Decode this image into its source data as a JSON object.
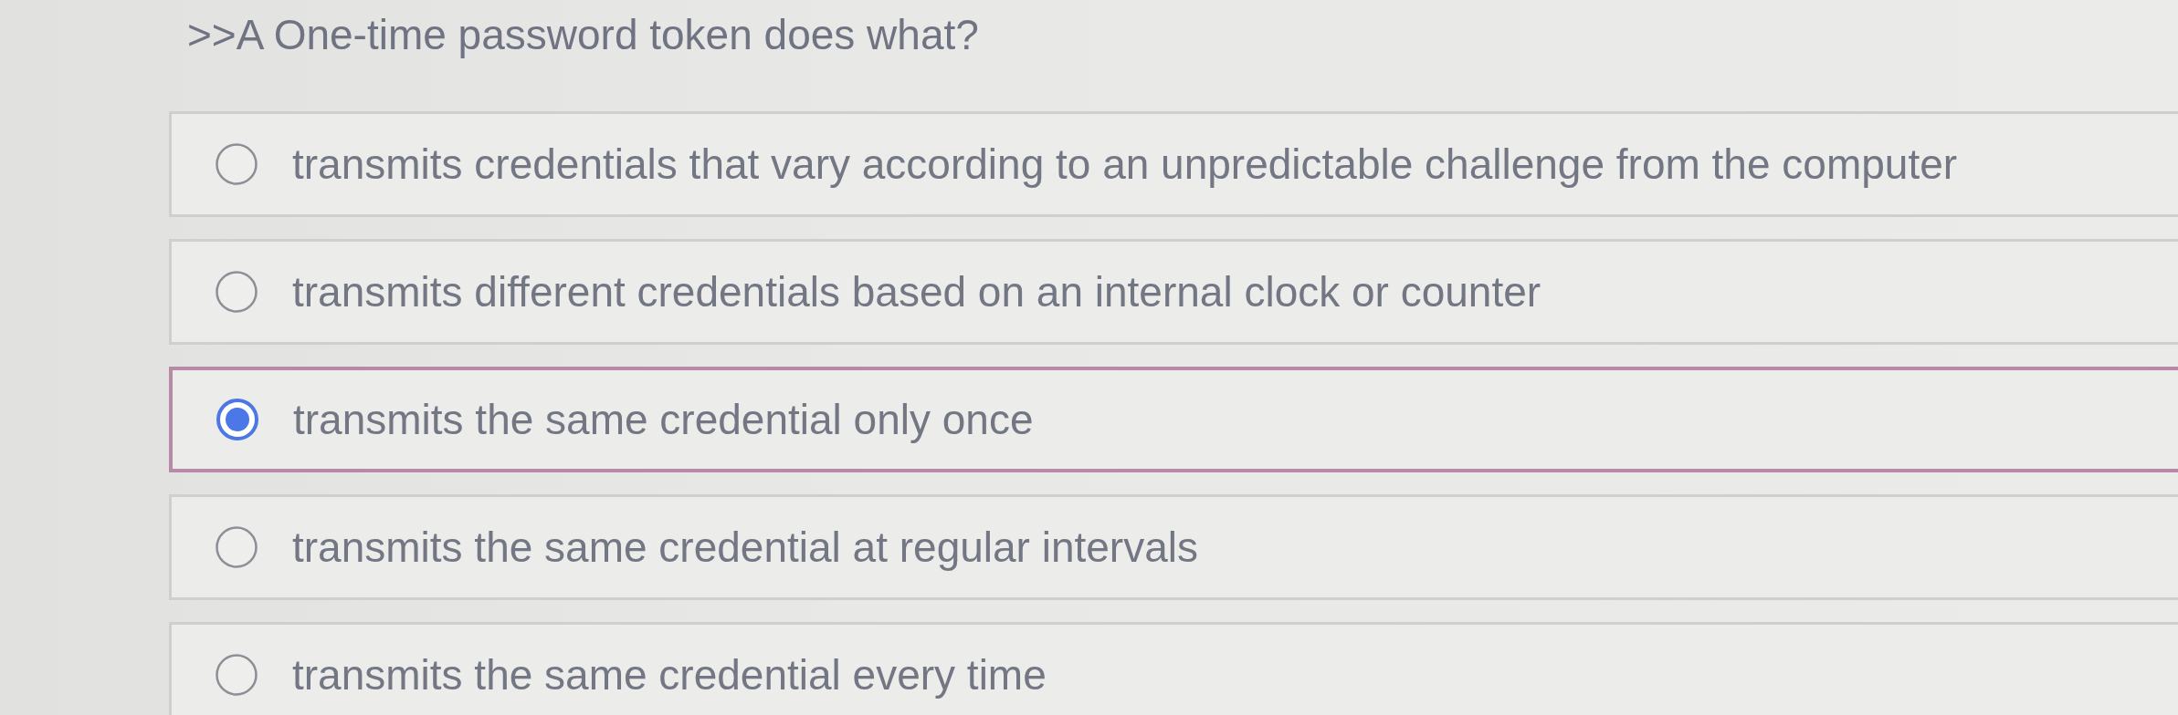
{
  "question": {
    "text": ">>A One-time password token does what?"
  },
  "options": [
    {
      "label": "transmits credentials that vary according to an unpredictable challenge from the computer",
      "selected": false
    },
    {
      "label": "transmits different credentials based on an internal clock or counter",
      "selected": false
    },
    {
      "label": "transmits the same credential only once",
      "selected": true
    },
    {
      "label": "transmits the same credential at regular intervals",
      "selected": false
    },
    {
      "label": "transmits the same credential every time",
      "selected": false
    }
  ]
}
